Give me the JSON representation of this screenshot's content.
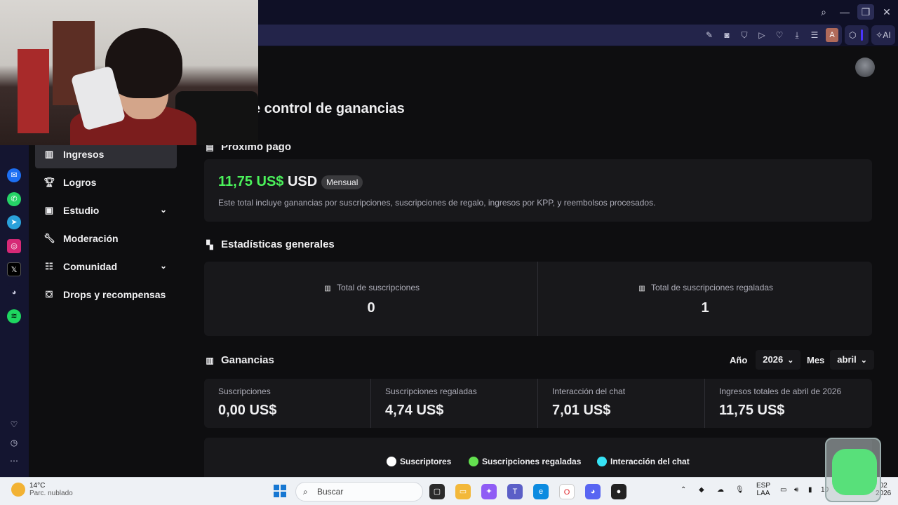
{
  "browser": {
    "window_controls": {
      "search": "⌕",
      "minimize": "—",
      "maximize": "❐",
      "close": "✕"
    },
    "toolbar_icons": [
      "edit-icon",
      "camera-icon",
      "shield-icon",
      "play-icon",
      "heart-icon",
      "download-icon",
      "menu-icon"
    ],
    "profile_letter": "A",
    "ai_label": "AI"
  },
  "sidebar_apps": [
    "messenger-icon",
    "whatsapp-icon",
    "telegram-icon",
    "instagram-icon",
    "x-icon",
    "discord-icon",
    "spotify-icon"
  ],
  "nav": {
    "items": [
      {
        "label": "Ingresos",
        "icon": "bar-chart-icon",
        "active": true,
        "expandable": false
      },
      {
        "label": "Logros",
        "icon": "trophy-icon",
        "active": false,
        "expandable": false
      },
      {
        "label": "Estudio",
        "icon": "studio-icon",
        "active": false,
        "expandable": true
      },
      {
        "label": "Moderación",
        "icon": "wrench-icon",
        "active": false,
        "expandable": false
      },
      {
        "label": "Comunidad",
        "icon": "community-icon",
        "active": false,
        "expandable": true
      },
      {
        "label": "Drops y recompensas",
        "icon": "gift-icon",
        "active": false,
        "expandable": false
      }
    ]
  },
  "page": {
    "title": "e control de ganancias"
  },
  "next_payment": {
    "section_title": "Próximo pago",
    "amount": "11,75 US$",
    "currency": "USD",
    "badge": "Mensual",
    "description": "Este total incluye ganancias por suscripciones, suscripciones de regalo, ingresos por KPP, y reembolsos procesados."
  },
  "general_stats": {
    "section_title": "Estadísticas generales",
    "items": [
      {
        "label": "Total de suscripciones",
        "value": "0"
      },
      {
        "label": "Total de suscripciones regaladas",
        "value": "1"
      }
    ]
  },
  "earnings": {
    "section_title": "Ganancias",
    "year_label": "Año",
    "year_value": "2026",
    "month_label": "Mes",
    "month_value": "abril",
    "cells": [
      {
        "label": "Suscripciones",
        "value": "0,00 US$"
      },
      {
        "label": "Suscripciones regaladas",
        "value": "4,74 US$"
      },
      {
        "label": "Interacción del chat",
        "value": "7,01 US$"
      },
      {
        "label": "Ingresos totales de abril de 2026",
        "value": "11,75 US$"
      }
    ],
    "legend": [
      {
        "label": "Suscriptores",
        "color": "#ffffff"
      },
      {
        "label": "Suscripciones regaladas",
        "color": "#63e04f"
      },
      {
        "label": "Interacción del chat",
        "color": "#36e3f5"
      }
    ]
  },
  "taskbar": {
    "weather_temp": "14°C",
    "weather_desc": "Parc. nublado",
    "search_placeholder": "Buscar",
    "lang_top": "ESP",
    "lang_bottom": "LAA",
    "battery": "10",
    "clock_partial_top": "02",
    "clock_partial_bottom": "2026"
  },
  "colors": {
    "accent_green": "#4bf25b",
    "card_bg": "#18181b",
    "page_bg": "#0e0e10"
  }
}
